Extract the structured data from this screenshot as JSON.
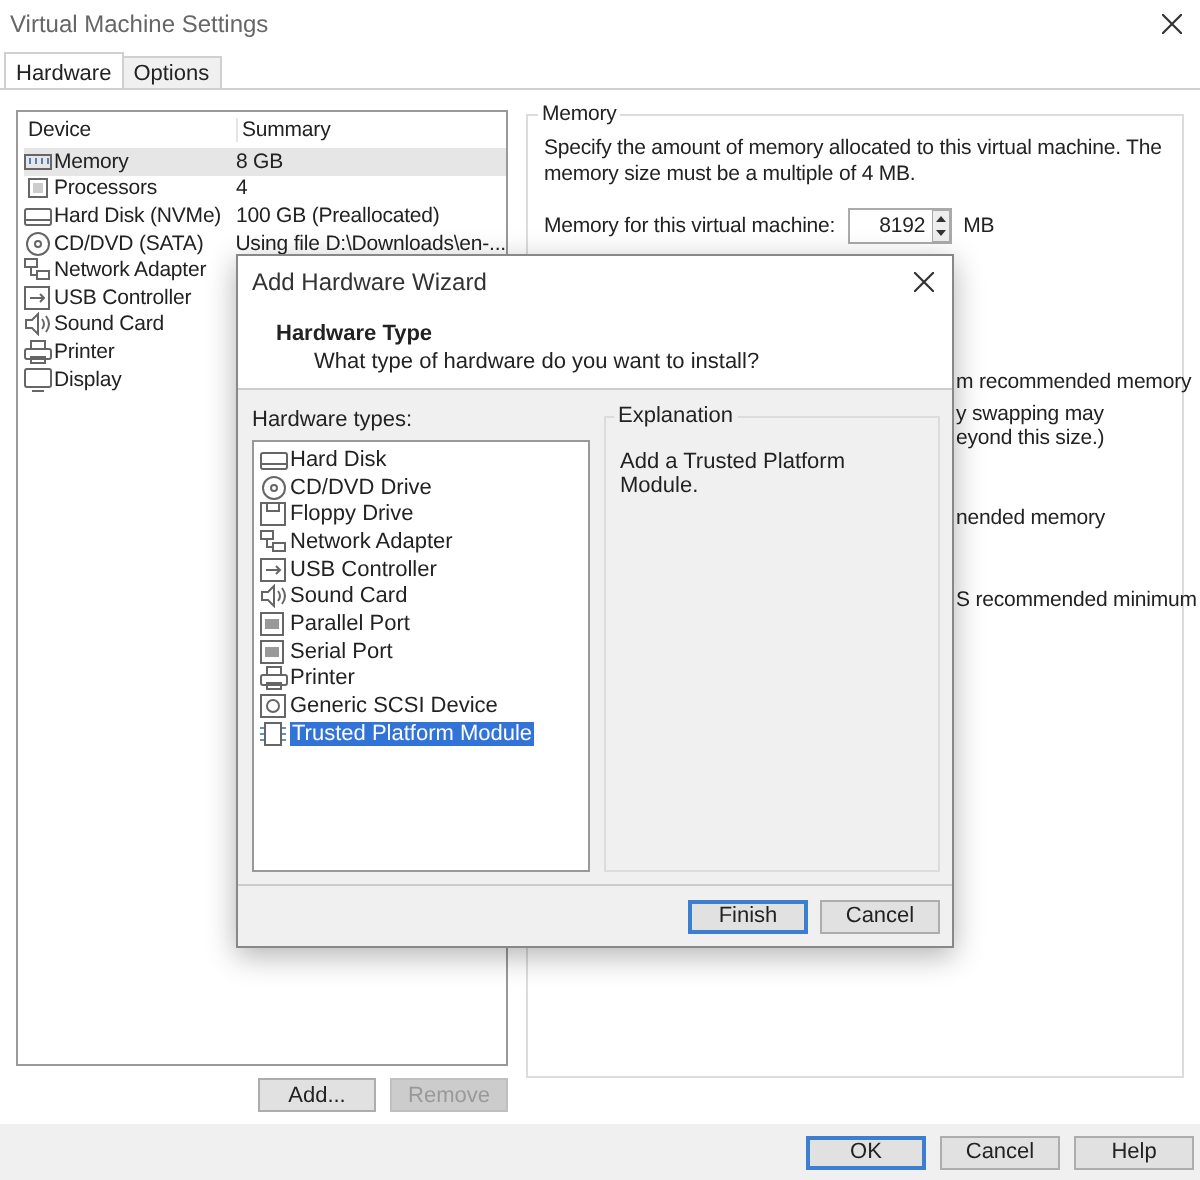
{
  "window": {
    "title": "Virtual Machine Settings"
  },
  "tabs": [
    {
      "label": "Hardware",
      "selected": true
    },
    {
      "label": "Options",
      "selected": false
    }
  ],
  "device_table": {
    "columns": [
      "Device",
      "Summary"
    ],
    "rows": [
      {
        "kind": "memory",
        "device": "Memory",
        "summary": "8 GB",
        "selected": true
      },
      {
        "kind": "processor",
        "device": "Processors",
        "summary": "4",
        "selected": false
      },
      {
        "kind": "disk",
        "device": "Hard Disk (NVMe)",
        "summary": "100 GB (Preallocated)",
        "selected": false
      },
      {
        "kind": "disc",
        "device": "CD/DVD (SATA)",
        "summary": "Using file D:\\Downloads\\en-...",
        "selected": false
      },
      {
        "kind": "network",
        "device": "Network Adapter",
        "summary": "",
        "selected": false
      },
      {
        "kind": "usb",
        "device": "USB Controller",
        "summary": "",
        "selected": false
      },
      {
        "kind": "sound",
        "device": "Sound Card",
        "summary": "",
        "selected": false
      },
      {
        "kind": "printer",
        "device": "Printer",
        "summary": "",
        "selected": false
      },
      {
        "kind": "display",
        "device": "Display",
        "summary": "",
        "selected": false
      }
    ]
  },
  "device_buttons": [
    {
      "label": "Add...",
      "disabled": false
    },
    {
      "label": "Remove",
      "disabled": true
    }
  ],
  "memory_panel": {
    "title": "Memory",
    "description": "Specify the amount of memory allocated to this virtual machine. The memory size must be a multiple of 4 MB.",
    "field_label": "Memory for this virtual machine:",
    "value": "8192",
    "unit": "MB",
    "visible_fragments": [
      "m recommended memory",
      "y swapping may",
      "eyond this size.)",
      "nended memory",
      "S recommended minimum"
    ]
  },
  "dialog_buttons": [
    {
      "label": "OK",
      "default": true
    },
    {
      "label": "Cancel",
      "default": false
    },
    {
      "label": "Help",
      "default": false
    }
  ],
  "wizard": {
    "title": "Add Hardware Wizard",
    "heading": "Hardware Type",
    "subheading": "What type of hardware do you want to install?",
    "list_label": "Hardware types:",
    "items": [
      {
        "kind": "disk",
        "label": "Hard Disk",
        "selected": false
      },
      {
        "kind": "disc",
        "label": "CD/DVD Drive",
        "selected": false
      },
      {
        "kind": "floppy",
        "label": "Floppy Drive",
        "selected": false
      },
      {
        "kind": "network",
        "label": "Network Adapter",
        "selected": false
      },
      {
        "kind": "usb",
        "label": "USB Controller",
        "selected": false
      },
      {
        "kind": "sound",
        "label": "Sound Card",
        "selected": false
      },
      {
        "kind": "port",
        "label": "Parallel Port",
        "selected": false
      },
      {
        "kind": "port",
        "label": "Serial Port",
        "selected": false
      },
      {
        "kind": "printer",
        "label": "Printer",
        "selected": false
      },
      {
        "kind": "scsi",
        "label": "Generic SCSI Device",
        "selected": false
      },
      {
        "kind": "tpm",
        "label": "Trusted Platform Module",
        "selected": true
      }
    ],
    "explanation_title": "Explanation",
    "explanation": "Add a Trusted Platform Module.",
    "buttons": [
      {
        "label": "Finish",
        "default": true
      },
      {
        "label": "Cancel",
        "default": false
      }
    ]
  }
}
